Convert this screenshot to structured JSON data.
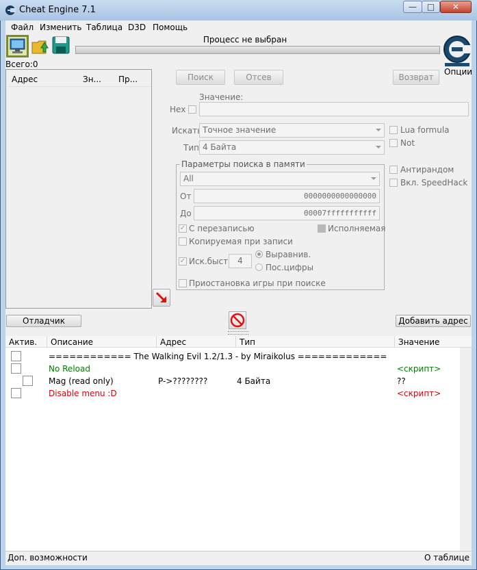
{
  "window": {
    "title": "Cheat Engine 7.1",
    "minimize": "—",
    "maximize": "□",
    "close": "✕"
  },
  "menu": [
    "Файл",
    "Изменить",
    "Таблица",
    "D3D",
    "Помощь"
  ],
  "toolbar": {
    "process_label": "Процесс не выбран",
    "options_label": "Опции"
  },
  "results": {
    "count_label": "Всего:0",
    "columns": [
      "Адрес",
      "Зн...",
      "Пр..."
    ]
  },
  "scan": {
    "first_scan": "Поиск",
    "next_scan": "Отсев",
    "undo_scan": "Возврат",
    "value_label": "Значение:",
    "hex_label": "Hex",
    "scan_type_label": "Искать",
    "scan_type_value": "Точное значение",
    "value_type_label": "Тип",
    "value_type_value": "4 Байта",
    "lua_formula": "Lua formula",
    "not_label": "Not",
    "antirandom": "Антирандом",
    "speedhack": "Вкл. SpeedHack"
  },
  "memory": {
    "group_title": "Параметры поиска в памяти",
    "region": "All",
    "from_label": "От",
    "from_value": "0000000000000000",
    "to_label": "До",
    "to_value": "00007fffffffffff",
    "writable": "С перезаписью",
    "executable": "Исполняемая",
    "copy_on_write": "Копируемая при записи",
    "fast_scan": "Иск.быст.",
    "fast_scan_value": "4",
    "alignment": "Выравнив.",
    "last_digits": "Пос.цифры",
    "pause_game": "Приостановка игры при поиске"
  },
  "buttons": {
    "debugger": "Отладчик",
    "add_address": "Добавить адрес"
  },
  "table": {
    "columns": [
      "Актив.",
      "Описание",
      "Адрес",
      "Тип",
      "Значение"
    ],
    "rows": [
      {
        "description": "============ The Walking Evil 1.2/1.3 - by Miraikolus  =============",
        "address": "",
        "type": "",
        "value": "",
        "color": "#000000"
      },
      {
        "description": "No Reload",
        "address": "",
        "type": "",
        "value": "<скрипт>",
        "color": "#008000"
      },
      {
        "description": "Mag (read only)",
        "address": "P->????????",
        "type": "4 Байта",
        "value": "??",
        "color": "#000000"
      },
      {
        "description": "Disable menu :D",
        "address": "",
        "type": "",
        "value": "<скрипт>",
        "color": "#e00000"
      }
    ]
  },
  "statusbar": {
    "left": "Доп. возможности",
    "right": "О таблице"
  }
}
